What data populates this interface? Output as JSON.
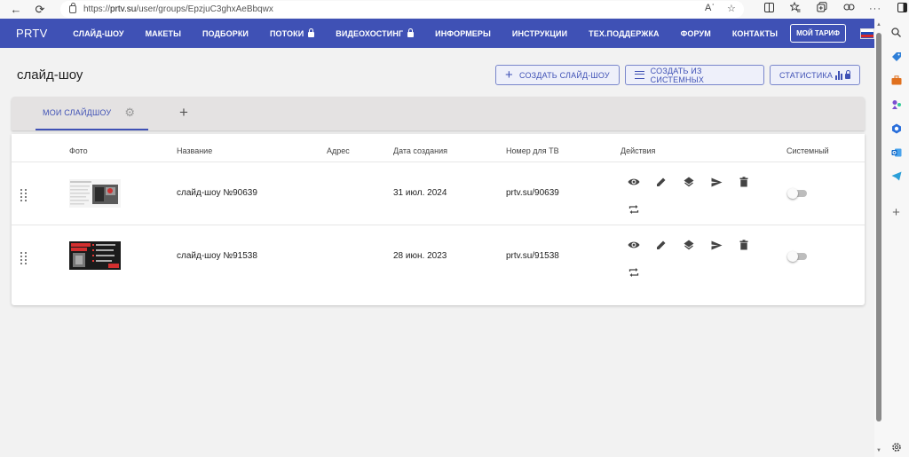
{
  "browser": {
    "url_prefix": "https://",
    "url_host": "prtv.su",
    "url_path": "/user/groups/EpzjuC3ghxAeBbqwx",
    "back_icon": "←",
    "refresh_icon": "⟳",
    "read_aloud_icon": "Aʾ",
    "star_icon": "☆"
  },
  "topnav": {
    "brand": "PRTV",
    "menu": [
      {
        "label": "СЛАЙД-ШОУ",
        "locked": false
      },
      {
        "label": "МАКЕТЫ",
        "locked": false
      },
      {
        "label": "ПОДБОРКИ",
        "locked": false
      },
      {
        "label": "ПОТОКИ",
        "locked": true
      },
      {
        "label": "ВИДЕОХОСТИНГ",
        "locked": true
      },
      {
        "label": "ИНФОРМЕРЫ",
        "locked": false
      },
      {
        "label": "ИНСТРУКЦИИ",
        "locked": false
      },
      {
        "label": "ТЕХ.ПОДДЕРЖКА",
        "locked": false
      },
      {
        "label": "ФОРУМ",
        "locked": false
      },
      {
        "label": "КОНТАКТЫ",
        "locked": false
      }
    ],
    "tariff_button": "МОЙ ТАРИФ",
    "accent_color": "#3f51b5"
  },
  "page": {
    "title": "слайд-шоу",
    "create_button": "СОЗДАТЬ СЛАЙД-ШОУ",
    "create_from_system_button": "СОЗДАТЬ ИЗ СИСТЕМНЫХ",
    "stats_button": "СТАТИСТИКА"
  },
  "tabs": {
    "active_tab": "МОИ СЛАЙДШОУ",
    "add_tab": "+"
  },
  "table": {
    "headers": {
      "photo": "Фото",
      "name": "Название",
      "address": "Адрес",
      "created": "Дата создания",
      "tv_number": "Номер для ТВ",
      "actions": "Действия",
      "system": "Системный"
    },
    "rows": [
      {
        "name": "слайд-шоу №90639",
        "address": "",
        "created": "31 июл. 2024",
        "tv_number": "prtv.su/90639",
        "system": false
      },
      {
        "name": "слайд-шоу №91538",
        "address": "",
        "created": "28 июн. 2023",
        "tv_number": "prtv.su/91538",
        "system": false
      }
    ]
  }
}
